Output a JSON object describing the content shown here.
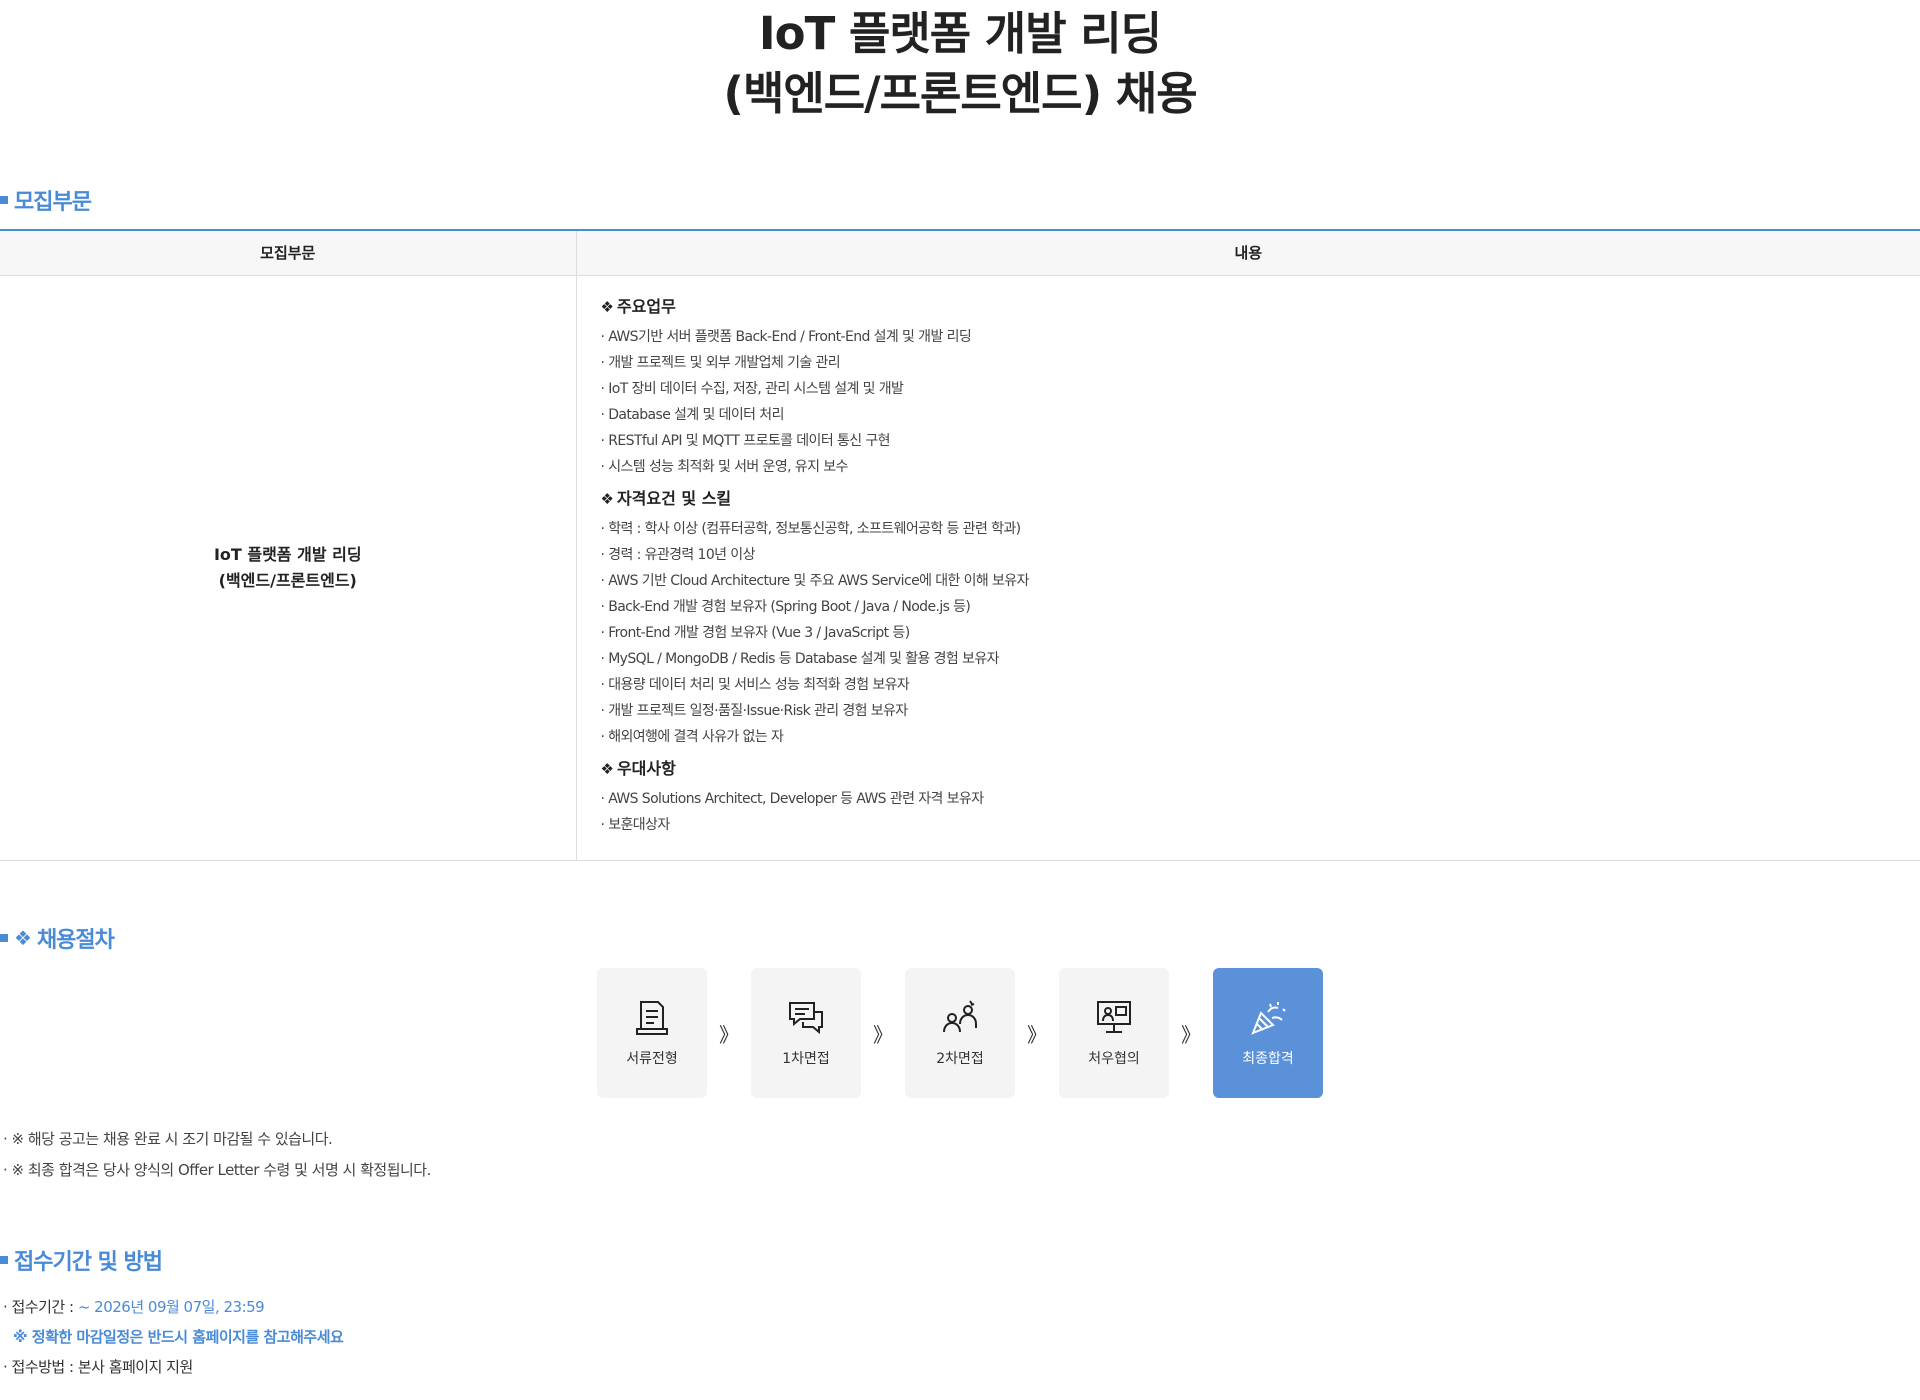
{
  "title": {
    "line1": "IoT 플랫폼 개발 리딩",
    "line2": "(백엔드/프론트엔드) 채용"
  },
  "sections": {
    "recruit": "모집부문",
    "process": "채용절차",
    "apply": "접수기간 및 방법"
  },
  "table": {
    "headers": [
      "모집부문",
      "내용"
    ],
    "position_line1": "IoT 플랫폼 개발 리딩",
    "position_line2": "(백엔드/프론트엔드)",
    "blocks": [
      {
        "title": "주요업무",
        "items": [
          "AWS기반 서버 플랫폼 Back-End / Front-End 설계 및 개발 리딩",
          "개발 프로젝트 및 외부 개발업체 기술 관리",
          "IoT 장비 데이터 수집, 저장, 관리 시스템 설계 및 개발",
          "Database 설계 및 데이터 처리",
          "RESTful API 및 MQTT 프로토콜 데이터 통신 구현",
          "시스템 성능 최적화 및 서버 운영, 유지 보수"
        ]
      },
      {
        "title": "자격요건 및 스킬",
        "items": [
          "학력 : 학사 이상 (컴퓨터공학, 정보통신공학, 소프트웨어공학 등 관련 학과)",
          "경력 : 유관경력 10년 이상",
          "AWS 기반 Cloud Architecture 및 주요 AWS Service에 대한 이해 보유자",
          "Back-End 개발 경험 보유자 (Spring Boot / Java / Node.js 등)",
          "Front-End 개발 경험 보유자 (Vue 3 / JavaScript 등)",
          "MySQL / MongoDB / Redis 등 Database 설계 및 활용 경험 보유자",
          "대용량 데이터 처리 및 서비스 성능 최적화 경험 보유자",
          "개발 프로젝트 일정·품질·Issue·Risk 관리 경험 보유자",
          "해외여행에 결격 사유가 없는 자"
        ]
      },
      {
        "title": "우대사항",
        "items": [
          "AWS Solutions Architect, Developer 등 AWS 관련 자격 보유자",
          "보훈대상자"
        ]
      }
    ]
  },
  "process": {
    "steps": [
      {
        "label": "서류전형",
        "icon": "document-icon"
      },
      {
        "label": "1차면접",
        "icon": "chat-bubbles-icon"
      },
      {
        "label": "2차면접",
        "icon": "people-icon"
      },
      {
        "label": "처우협의",
        "icon": "monitor-meeting-icon"
      },
      {
        "label": "최종합격",
        "icon": "party-popper-icon"
      }
    ],
    "arrow": "》",
    "final_color": "#5b91d8"
  },
  "notes": [
    "· ※ 해당 공고는 채용 완료 시 조기 마감될 수 있습니다.",
    "· ※ 최종 합격은 당사 양식의 Offer Letter 수령 및 서명 시 확정됩니다."
  ],
  "apply": {
    "period_label": "· 접수기간 : ",
    "period_value": "~ 2026년 09월 07일, 23:59",
    "warning": "※ 정확한 마감일정은 반드시 홈페이지를 참고해주세요",
    "method": "· 접수방법 : 본사 홈페이지 지원"
  },
  "colors": {
    "accent": "#4a8bd6"
  }
}
